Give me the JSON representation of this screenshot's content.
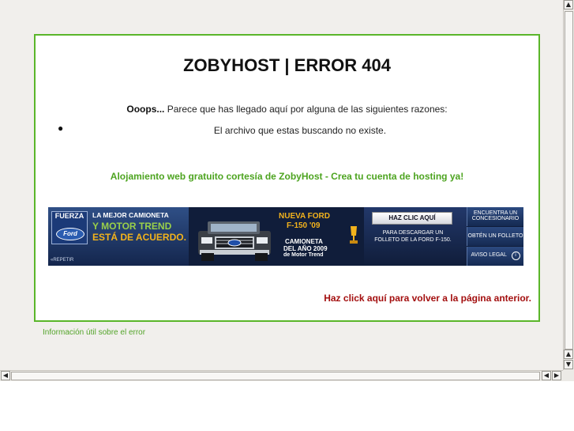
{
  "page": {
    "title": "ZOBYHOST | ERROR 404",
    "intro_bold": "Ooops...",
    "intro_rest": " Parece que has llegado aquí por alguna de las siguientes razones:",
    "reasons": [
      "El archivo que estas buscando no existe."
    ],
    "promo": "Alojamiento web gratuito cortesía de ZobyHost - Crea tu cuenta de hosting ya!",
    "back_link": "Haz click aquí para volver a la página anterior.",
    "info_link": "Información útil sobre el error"
  },
  "banner": {
    "fuerza": "FUERZA",
    "ford_logo": "Ford",
    "headline_1": "LA MEJOR CAMIONETA",
    "headline_2": "Y MOTOR TREND",
    "headline_3": "ESTÁ DE ACUERDO.",
    "model_1": "NUEVA FORD",
    "model_2": "F-150 '09",
    "award_1": "CAMIONETA",
    "award_2": "DEL AÑO 2009",
    "award_3": "de Motor Trend",
    "cta_button": "HAZ CLIC AQUÍ",
    "cta_text_1": "PARA DESCARGAR UN",
    "cta_text_2": "FOLLETO DE LA FORD F-150.",
    "side_1a": "ENCUENTRA UN",
    "side_1b": "CONCESIONARIO",
    "side_2": "OBTÉN UN FOLLETO",
    "side_3": "AVISO LEGAL",
    "replay": "«REPETIR",
    "colors": {
      "gold": "#f3b31c",
      "green_title": "#9ad04a",
      "navy": "#101d3a"
    }
  },
  "colors": {
    "border_green": "#5ab62a",
    "promo_green": "#4da420",
    "back_red": "#a30f0f",
    "page_bg": "#f1efec"
  },
  "scrollbars": {
    "up": "▲",
    "down": "▼",
    "left": "◀",
    "right": "▶"
  }
}
